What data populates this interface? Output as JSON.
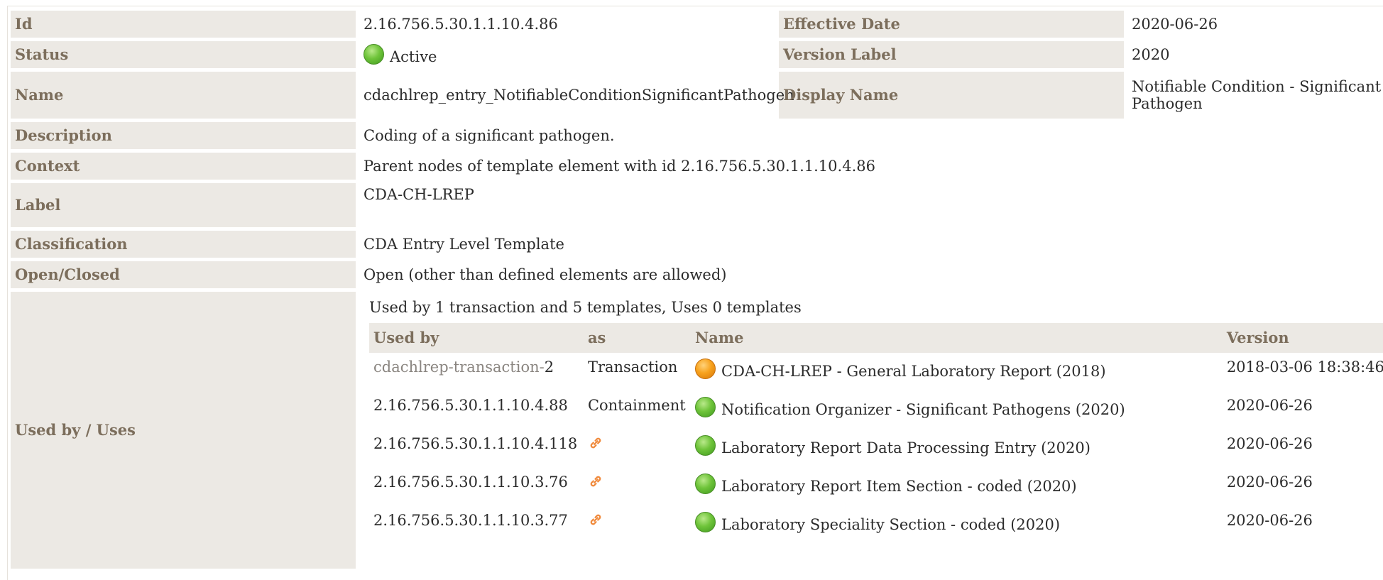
{
  "rows": {
    "id": {
      "label": "Id",
      "value": "2.16.756.5.30.1.1.10.4.86"
    },
    "effective_date": {
      "label": "Effective Date",
      "value": "2020-06-26"
    },
    "status": {
      "label": "Status",
      "value": "Active",
      "status_color": "#6fc43a"
    },
    "version_label": {
      "label": "Version Label",
      "value": "2020"
    },
    "name": {
      "label": "Name",
      "value": "cdachlrep_entry_NotifiableConditionSignificantPathogen"
    },
    "display_name": {
      "label": "Display Name",
      "value": "Notifiable Condition - Significant Pathogen"
    },
    "description": {
      "label": "Description",
      "value": "Coding of a significant pathogen."
    },
    "context": {
      "label": "Context",
      "value": "Parent nodes of template element with id 2.16.756.5.30.1.1.10.4.86"
    },
    "label": {
      "label": "Label",
      "value": "CDA-CH-LREP"
    },
    "classification": {
      "label": "Classification",
      "value": "CDA Entry Level Template"
    },
    "open_closed": {
      "label": "Open/Closed",
      "value": "Open (other than defined elements are allowed)"
    },
    "used_by_uses": {
      "label": "Used by / Uses"
    }
  },
  "uses": {
    "summary": "Used by 1 transaction and 5 templates, Uses 0 templates",
    "headers": {
      "used_by": "Used by",
      "as": "as",
      "name": "Name",
      "version": "Version"
    },
    "items": [
      {
        "used_by_prefix": "cdachlrep-transaction-",
        "used_by_suffix": "2",
        "as": "Transaction",
        "status": "orange",
        "name": "CDA-CH-LREP - General Laboratory Report (2018)",
        "version": "2018-03-06 18:38:46"
      },
      {
        "used_by": "2.16.756.5.30.1.1.10.4.88",
        "as": "Containment",
        "status": "green",
        "name": "Notification Organizer - Significant Pathogens (2020)",
        "version": "2020-06-26"
      },
      {
        "used_by": "2.16.756.5.30.1.1.10.4.118",
        "as_icon": "link-icon",
        "status": "green",
        "name": "Laboratory Report Data Processing Entry (2020)",
        "version": "2020-06-26"
      },
      {
        "used_by": "2.16.756.5.30.1.1.10.3.76",
        "as_icon": "link-icon",
        "status": "green",
        "name": "Laboratory Report Item Section - coded (2020)",
        "version": "2020-06-26"
      },
      {
        "used_by": "2.16.756.5.30.1.1.10.3.77",
        "as_icon": "link-icon",
        "status": "green",
        "name": "Laboratory Speciality Section - coded (2020)",
        "version": "2020-06-26"
      }
    ]
  },
  "colors": {
    "label_bg": "#ece9e4",
    "label_text": "#7c6e5c",
    "link_icon": "#f08a3c"
  }
}
